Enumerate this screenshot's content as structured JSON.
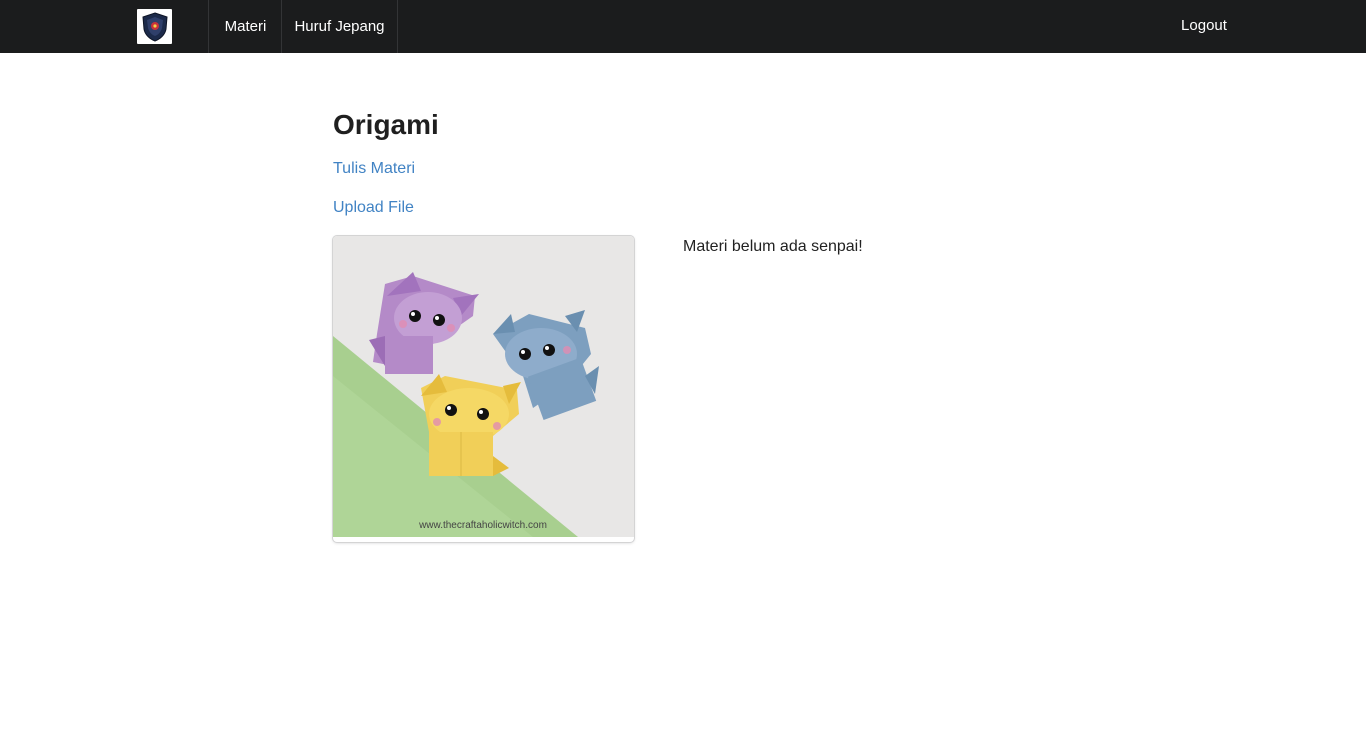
{
  "navbar": {
    "logo_icon": "shield-logo-icon",
    "items": [
      {
        "label": "Materi"
      },
      {
        "label": "Huruf Jepang"
      }
    ],
    "logout_label": "Logout"
  },
  "content": {
    "title": "Origami",
    "links": [
      {
        "label": "Tulis Materi"
      },
      {
        "label": "Upload File"
      }
    ],
    "image": {
      "caption": "www.thecraftaholicwitch.com",
      "icon": "origami-cats-image"
    },
    "message": "Materi belum ada senpai!"
  },
  "colors": {
    "navbar_bg": "#1b1c1d",
    "link": "#4183c4",
    "paper_green": "#a8cf8f"
  }
}
